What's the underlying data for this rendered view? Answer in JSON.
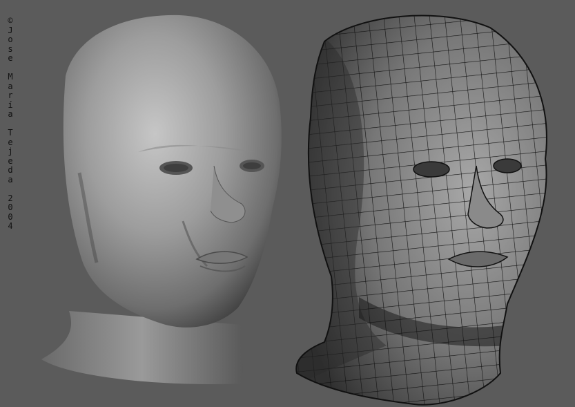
{
  "render": {
    "background_color": "#5b5b5b",
    "copyright_lines": [
      "©",
      "J",
      "o",
      "s",
      "e",
      "",
      "M",
      "a",
      "r",
      "í",
      "a",
      "",
      "T",
      "e",
      "j",
      "e",
      "d",
      "a",
      "",
      "2",
      "0",
      "0",
      "4"
    ],
    "copyright_text": "© Jose María Tejeda 2004"
  }
}
